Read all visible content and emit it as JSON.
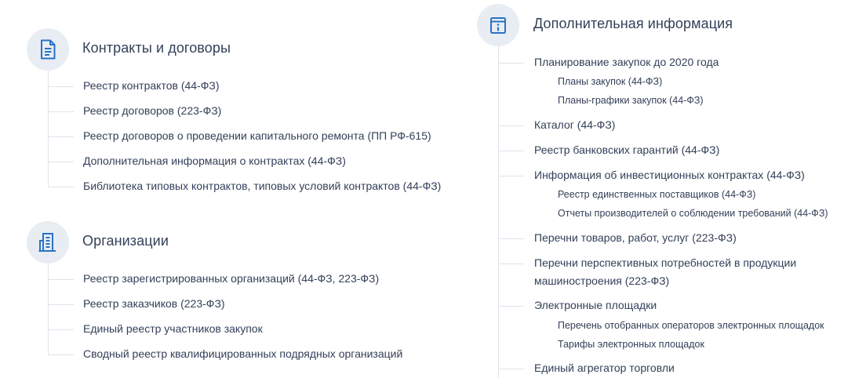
{
  "contracts": {
    "title": "Контракты и договоры",
    "icon": "document-icon",
    "items": [
      "Реестр контрактов (44-ФЗ)",
      "Реестр договоров (223-ФЗ)",
      "Реестр договоров о проведении капитального ремонта (ПП РФ-615)",
      "Дополнительная информация о контрактах (44-ФЗ)",
      "Библиотека типовых контрактов, типовых условий контрактов (44-ФЗ)"
    ]
  },
  "organizations": {
    "title": "Организации",
    "icon": "building-icon",
    "items": [
      "Реестр зарегистрированных организаций (44-ФЗ, 223-ФЗ)",
      "Реестр заказчиков (223-ФЗ)",
      "Единый реестр участников закупок",
      "Сводный реестр квалифицированных подрядных организаций"
    ]
  },
  "additional": {
    "title": "Дополнительная информация",
    "icon": "info-icon",
    "items": [
      {
        "label": "Планирование закупок до 2020 года",
        "children": [
          "Планы закупок (44-ФЗ)",
          "Планы-графики закупок (44-ФЗ)"
        ]
      },
      {
        "label": "Каталог (44-ФЗ)",
        "children": []
      },
      {
        "label": "Реестр банковских гарантий (44-ФЗ)",
        "children": []
      },
      {
        "label": "Информация об инвестиционных контрактах (44-ФЗ)",
        "children": [
          "Реестр единственных поставщиков (44-ФЗ)",
          "Отчеты производителей о соблюдении требований (44-ФЗ)"
        ]
      },
      {
        "label": "Перечни товаров, работ, услуг (223-ФЗ)",
        "children": []
      },
      {
        "label_line1": "Перечни перспективных потребностей в продукции",
        "label_line2": "машиностроения (223-ФЗ)",
        "children": []
      },
      {
        "label": "Электронные площадки",
        "children": [
          "Перечень отобранных операторов электронных площадок",
          "Тарифы электронных площадок"
        ]
      },
      {
        "label": "Единый агрегатор торговли",
        "children": []
      }
    ]
  }
}
